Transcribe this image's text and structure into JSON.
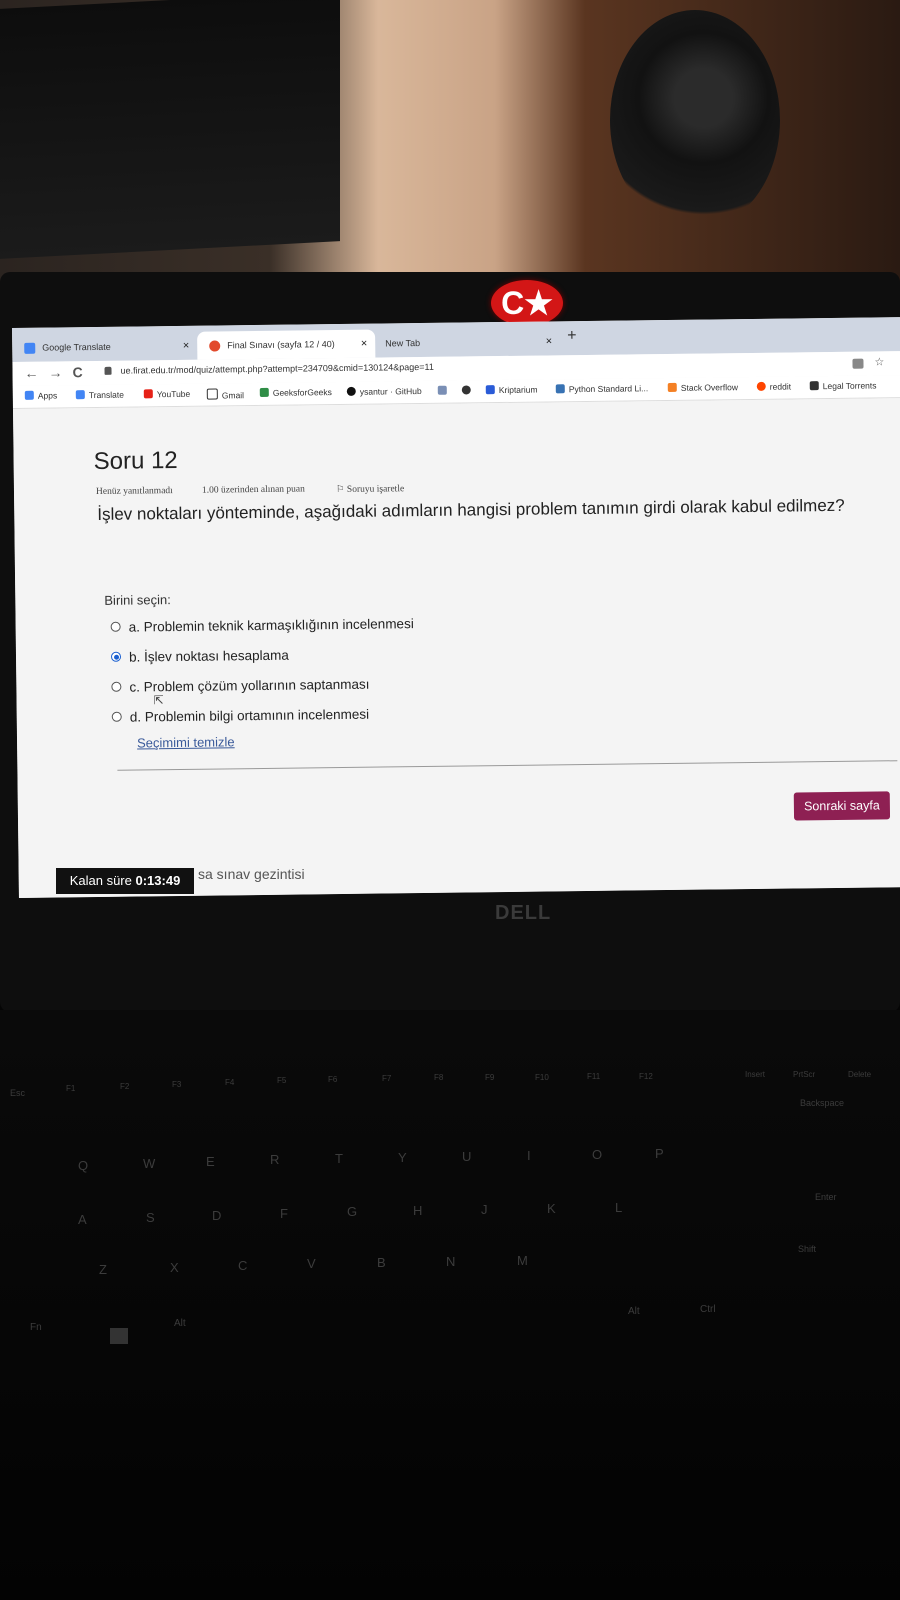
{
  "browser": {
    "tabs": [
      {
        "label": "Google Translate",
        "close": "×"
      },
      {
        "label": "Final Sınavı (sayfa 12 / 40)",
        "close": "×"
      },
      {
        "label": "New Tab",
        "close": "×"
      }
    ],
    "new_tab": "+",
    "nav": {
      "back": "←",
      "forward": "→",
      "reload": "C"
    },
    "url": "ue.firat.edu.tr/mod/quiz/attempt.php?attempt=234709&cmid=130124&page=11",
    "toolbar_right": {
      "translate_icon": "translate-icon",
      "star": "☆"
    },
    "bookmarks": [
      {
        "label": "Apps",
        "color": "#4285f4"
      },
      {
        "label": "Translate",
        "color": "#4285f4"
      },
      {
        "label": "YouTube",
        "color": "#e62117"
      },
      {
        "label": "Gmail",
        "color": "#333333"
      },
      {
        "label": "GeeksforGeeks",
        "color": "#2f8d46"
      },
      {
        "label": "ysantur · GitHub",
        "color": "#111111"
      },
      {
        "label": "",
        "color": "#7a8fb5"
      },
      {
        "label": "",
        "color": "#333333"
      },
      {
        "label": "Kriptarium",
        "color": "#2a5bd7"
      },
      {
        "label": "Python Standard Li...",
        "color": "#3872b3"
      },
      {
        "label": "Stack Overflow",
        "color": "#f48024"
      },
      {
        "label": "reddit",
        "color": "#ff4500"
      },
      {
        "label": "Legal Torrents",
        "color": "#333333"
      }
    ]
  },
  "quiz": {
    "title": "Soru 12",
    "status": "Henüz yanıtlanmadı",
    "points": "1.00 üzerinden alınan puan",
    "flag": "Soruyu işaretle",
    "question": "İşlev noktaları yönteminde, aşağıdaki adımların hangisi problem tanımın girdi olarak kabul edilmez?",
    "choose_label": "Birini seçin:",
    "options": [
      {
        "label": "a. Problemin teknik karmaşıklığının incelenmesi",
        "selected": false
      },
      {
        "label": "b. İşlev noktası hesaplama",
        "selected": true
      },
      {
        "label": "c. Problem çözüm yollarının saptanması",
        "selected": false
      },
      {
        "label": "d. Problemin bilgi ortamının incelenmesi",
        "selected": false
      }
    ],
    "clear_choice": "Seçimimi temizle",
    "next_button": "Sonraki sayfa",
    "accent_color": "#8e2053"
  },
  "timer": {
    "label": "Kalan süre",
    "value": "0:13:49"
  },
  "quiz_nav_partial": "sa sınav gezintisi",
  "device": {
    "flag_symbol": "C★",
    "brand": "DELL"
  },
  "keyboard_keys": [
    "Esc",
    "F1",
    "F2",
    "F3",
    "F4",
    "F5",
    "F6",
    "F7",
    "F8",
    "F9",
    "F10",
    "F11",
    "F12",
    "Insert",
    "PrtScr",
    "Delete",
    "Backspace",
    "Q",
    "W",
    "E",
    "R",
    "T",
    "Y",
    "U",
    "I",
    "O",
    "P",
    "A",
    "S",
    "D",
    "F",
    "G",
    "H",
    "J",
    "K",
    "L",
    "Enter",
    "Z",
    "X",
    "C",
    "V",
    "B",
    "N",
    "M",
    "Shift",
    "Fn",
    "Alt",
    "Alt",
    "Ctrl"
  ]
}
